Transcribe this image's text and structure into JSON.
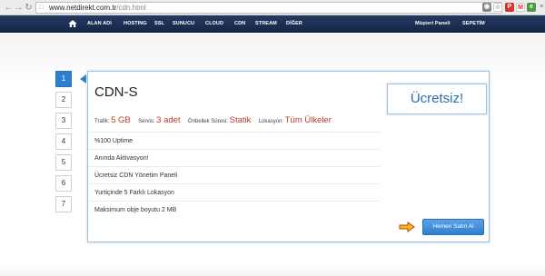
{
  "browser": {
    "url_host": "www.netdirekt.com.tr",
    "url_path": "/cdn.html"
  },
  "navbar": {
    "items": [
      "ALAN ADI",
      "HOSTING",
      "SSL",
      "SUNUCU",
      "CLOUD",
      "CDN",
      "STREAM",
      "DİĞER"
    ],
    "right_items": [
      "Müşteri Paneli",
      "SEPETİM"
    ]
  },
  "steps": [
    "1",
    "2",
    "3",
    "4",
    "5",
    "6",
    "7"
  ],
  "active_step": 1,
  "card": {
    "title": "CDN-S",
    "price": "Ücretsiz!",
    "specs": {
      "traffic_label": "Trafik:",
      "traffic_value": "5 GB",
      "service_label": "Servis:",
      "service_value": "3 adet",
      "cache_label": "Önbellek Süresi:",
      "cache_value": "Statik",
      "location_label": "Lokasyon:",
      "location_value": "Tüm Ülkeler"
    },
    "features": [
      "%100 Uptime",
      "Anında Aktivasyon!",
      "Ücretsiz CDN Yönetim Paneli",
      "Yurtiçinde 5 Farklı Lokasyon",
      "Maksimum obje boyutu 2 MB"
    ],
    "buy_label": "Hemen Satın Al"
  },
  "colors": {
    "nav_bg": "#1d3257",
    "accent": "#2f7fd1",
    "spec_value": "#c0392b"
  }
}
